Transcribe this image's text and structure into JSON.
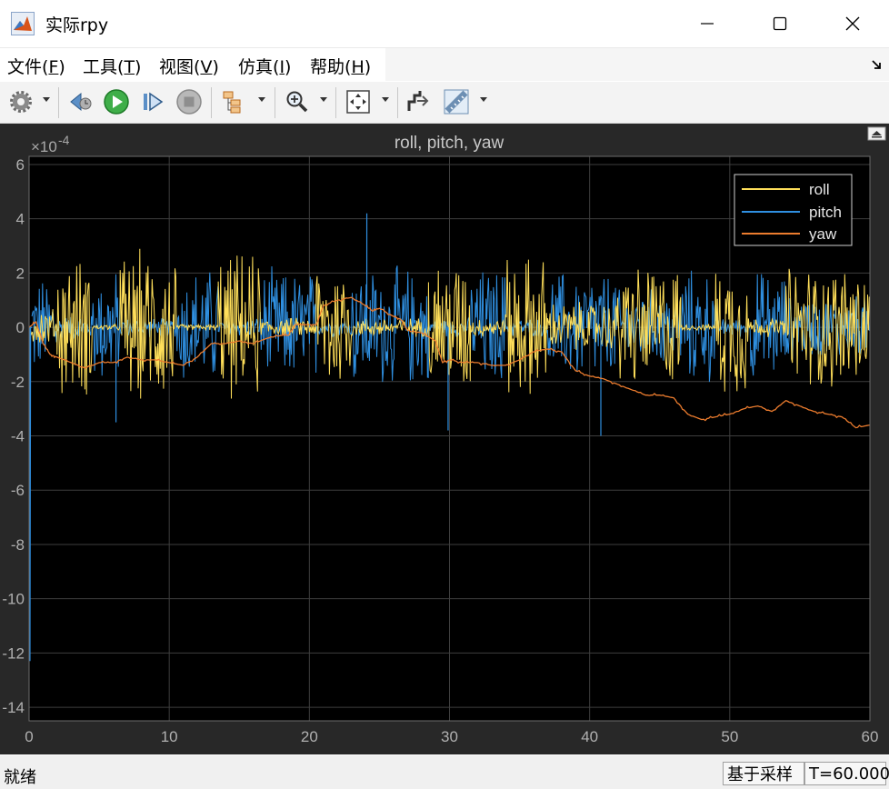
{
  "window": {
    "title": "实际rpy",
    "controls": {
      "minimize": "minimize",
      "maximize": "maximize",
      "close": "close"
    }
  },
  "menu": {
    "items": [
      {
        "label": "文件",
        "key": "F"
      },
      {
        "label": "工具",
        "key": "T"
      },
      {
        "label": "视图",
        "key": "V"
      },
      {
        "label": "仿真",
        "key": "I"
      },
      {
        "label": "帮助",
        "key": "H"
      }
    ]
  },
  "toolbar": {
    "buttons": [
      "settings-icon",
      "step-back-icon",
      "run-icon",
      "step-forward-icon",
      "stop-icon",
      "layout-icon",
      "zoom-icon",
      "autoscale-icon",
      "cursor-measure-icon",
      "ruler-icon"
    ]
  },
  "colors": {
    "roll": "#ffdf5a",
    "pitch": "#2f8fe0",
    "yaw": "#ec7c2e",
    "plot_bg": "#000000",
    "figure_bg": "#282828"
  },
  "chart_data": {
    "type": "line",
    "title": "roll, pitch, yaw",
    "exponent_label": "×10",
    "exponent_power": "-4",
    "xlim": [
      0,
      60
    ],
    "ylim": [
      -14.5,
      6.3
    ],
    "x_ticks": [
      "0",
      "10",
      "20",
      "30",
      "40",
      "50",
      "60"
    ],
    "y_ticks": [
      "6",
      "4",
      "2",
      "0",
      "-2",
      "-4",
      "-6",
      "-8",
      "-10",
      "-12",
      "-14"
    ],
    "y_tick_values": [
      6,
      4,
      2,
      0,
      -2,
      -4,
      -6,
      -8,
      -10,
      -12,
      -14
    ],
    "x_tick_values": [
      0,
      10,
      20,
      30,
      40,
      50,
      60
    ],
    "grid": true,
    "legend": "top-right",
    "series": [
      {
        "name": "roll",
        "color": "#ffdf5a",
        "noise_segments": [
          {
            "x": [
              0,
              2
            ],
            "amp": 0.6
          },
          {
            "x": [
              2,
              4.5
            ],
            "amp": 2.2
          },
          {
            "x": [
              4.5,
              6.5
            ],
            "amp": 0.1
          },
          {
            "x": [
              6.5,
              10.5
            ],
            "amp": 2.4
          },
          {
            "x": [
              10.5,
              13.5
            ],
            "amp": 0.1
          },
          {
            "x": [
              13.5,
              16.5
            ],
            "amp": 2.3
          },
          {
            "x": [
              16.5,
              20.5
            ],
            "amp": 0.3
          },
          {
            "x": [
              20.5,
              23
            ],
            "amp": 2.2
          },
          {
            "x": [
              23,
              28.5
            ],
            "amp": 0.3
          },
          {
            "x": [
              28.5,
              31.5
            ],
            "amp": 2.2
          },
          {
            "x": [
              31.5,
              34
            ],
            "amp": 0.3
          },
          {
            "x": [
              34,
              37
            ],
            "amp": 2.3
          },
          {
            "x": [
              37,
              42
            ],
            "amp": 0.8
          },
          {
            "x": [
              42,
              46.5
            ],
            "amp": 2.0
          },
          {
            "x": [
              46.5,
              49
            ],
            "amp": 0.1
          },
          {
            "x": [
              49,
              51.5
            ],
            "amp": 2.2
          },
          {
            "x": [
              51.5,
              54
            ],
            "amp": 0.3
          },
          {
            "x": [
              54,
              60
            ],
            "amp": 2.0
          }
        ]
      },
      {
        "name": "pitch",
        "color": "#2f8fe0",
        "x": [
          0,
          0.05,
          0.1,
          0.2
        ],
        "values": [
          0,
          -12.3,
          0,
          0
        ],
        "noise_segments": [
          {
            "x": [
              0.2,
              2
            ],
            "amp": 1.6
          },
          {
            "x": [
              2,
              4.5
            ],
            "amp": 0.4
          },
          {
            "x": [
              4.5,
              6.5
            ],
            "amp": 1.8
          },
          {
            "x": [
              6.5,
              10.5
            ],
            "amp": 0.3
          },
          {
            "x": [
              10.5,
              13.5
            ],
            "amp": 1.9
          },
          {
            "x": [
              13.5,
              16.5
            ],
            "amp": 0.3
          },
          {
            "x": [
              16.5,
              20.5
            ],
            "amp": 1.8
          },
          {
            "x": [
              20.5,
              23
            ],
            "amp": 0.3
          },
          {
            "x": [
              23,
              28.5
            ],
            "amp": 1.9
          },
          {
            "x": [
              28.5,
              31.5
            ],
            "amp": 0.3
          },
          {
            "x": [
              31.5,
              34
            ],
            "amp": 1.9
          },
          {
            "x": [
              34,
              37
            ],
            "amp": 0.3
          },
          {
            "x": [
              37,
              42
            ],
            "amp": 1.8
          },
          {
            "x": [
              42,
              46.5
            ],
            "amp": 1.2
          },
          {
            "x": [
              46.5,
              49
            ],
            "amp": 1.8
          },
          {
            "x": [
              49,
              51.5
            ],
            "amp": 0.3
          },
          {
            "x": [
              51.5,
              54
            ],
            "amp": 1.8
          },
          {
            "x": [
              54,
              60
            ],
            "amp": 1.0
          }
        ],
        "spikes": [
          [
            24.1,
            4.2
          ],
          [
            40.8,
            -4.0
          ],
          [
            29.9,
            -3.8
          ],
          [
            6.2,
            -3.5
          ]
        ]
      },
      {
        "name": "yaw",
        "color": "#ec7c2e",
        "x": [
          0,
          0.5,
          1,
          1.5,
          2,
          3,
          4,
          5,
          6,
          7,
          8,
          9,
          10,
          11,
          12,
          13,
          14,
          15,
          16,
          17,
          18,
          18.5,
          19,
          20,
          20.5,
          21,
          22,
          23,
          24,
          24.5,
          25,
          26,
          26.5,
          27,
          28,
          29,
          29.5,
          30,
          31,
          32,
          33,
          34,
          35,
          36,
          37,
          38,
          39,
          40,
          41,
          42,
          43,
          44,
          45,
          46,
          47,
          48,
          49,
          50,
          51,
          52,
          53,
          54,
          55,
          56,
          57,
          58,
          59,
          60
        ],
        "values": [
          0,
          0.2,
          -0.6,
          -1.0,
          -1.1,
          -1.3,
          -1.5,
          -1.3,
          -1.3,
          -1.1,
          -1.2,
          -1.2,
          -1.3,
          -1.4,
          -1.1,
          -0.6,
          -0.6,
          -0.5,
          -0.6,
          -0.4,
          -0.3,
          -0.3,
          0.1,
          0.1,
          0.1,
          0.8,
          1.0,
          1.1,
          0.8,
          0.6,
          0.7,
          0.4,
          0.3,
          -0.1,
          -0.2,
          -0.5,
          -1.3,
          -1.2,
          -1.3,
          -1.3,
          -1.4,
          -1.4,
          -1.2,
          -0.9,
          -0.8,
          -0.9,
          -1.6,
          -1.8,
          -1.9,
          -2.1,
          -2.3,
          -2.5,
          -2.5,
          -2.6,
          -3.2,
          -3.4,
          -3.3,
          -3.2,
          -3.0,
          -2.9,
          -3.1,
          -2.7,
          -2.9,
          -3.1,
          -3.2,
          -3.3,
          -3.7,
          -3.6
        ]
      }
    ]
  },
  "status": {
    "ready": "就绪",
    "sampling": "基于采样",
    "time": "T=60.000"
  }
}
